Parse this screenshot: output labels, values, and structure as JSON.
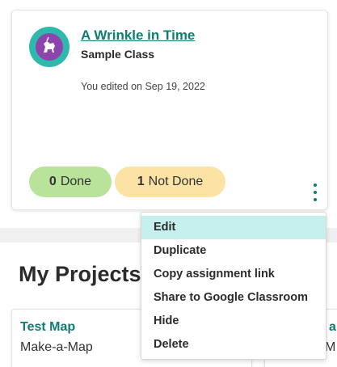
{
  "assignment": {
    "title": "A Wrinkle in Time",
    "class_name": "Sample Class",
    "edited_text": "You edited on Sep 19, 2022",
    "done_count": "0",
    "done_label": "Done",
    "not_done_count": "1",
    "not_done_label": "Not Done"
  },
  "section": {
    "title": "My Projects"
  },
  "projects": [
    {
      "title": "Test Map",
      "type": "Make-a-Map"
    },
    {
      "title": "a",
      "type": "M"
    }
  ],
  "menu": {
    "items": [
      "Edit",
      "Duplicate",
      "Copy assignment link",
      "Share to Google Classroom",
      "Hide",
      "Delete"
    ],
    "active_item": "Edit"
  },
  "icons": {
    "avatar": "unicorn-icon",
    "options": "vertical-ellipsis-icon"
  },
  "colors": {
    "accent_teal": "#0e7e72",
    "avatar_teal": "#2fb8ac",
    "avatar_purple": "#8e44ad",
    "done_green": "#b9e39a",
    "not_done_yellow": "#fbe3a6",
    "menu_highlight": "#c5f0ee"
  }
}
